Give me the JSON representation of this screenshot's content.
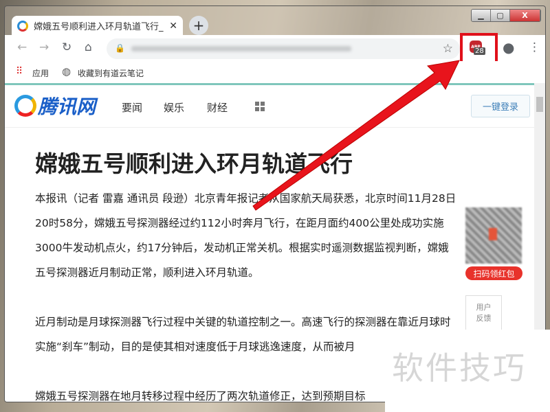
{
  "browser": {
    "tab_title": "嫦娥五号顺利进入环月轨道飞行_",
    "tab_close": "✕",
    "new_tab": "+",
    "window_controls": {
      "minimize": "▁",
      "maximize": "▢",
      "close": "X"
    },
    "abp_count": "28",
    "abp_label": "ABP",
    "bookmarks": [
      {
        "label": "应用",
        "icon": "apps-grid-icon"
      },
      {
        "label": "收藏到有道云笔记",
        "icon": "globe-icon"
      }
    ]
  },
  "site": {
    "logo": "腾讯网",
    "nav": [
      "要闻",
      "娱乐",
      "财经"
    ],
    "login": "一键登录"
  },
  "article": {
    "title": "嫦娥五号顺利进入环月轨道飞行",
    "para1": [
      "本报讯（记者 雷嘉 通讯员 段逊）北京青年报记者从国家航天局获悉，北京时间11月28日",
      "20时58分，嫦娥五号探测器经过约112小时奔月飞行，在距月面约400公里处成功实施",
      "3000牛发动机点火，约17分钟后，发动机正常关机。根据实时遥测数据监视判断，嫦娥",
      "五号探测器近月制动正常，顺利进入环月轨道。"
    ],
    "para2": [
      "近月制动是月球探测器飞行过程中关键的轨道控制之一。高速飞行的探测器在靠近月球时",
      "实施“刹车”制动，目的是使其相对速度低于月球逃逸速度，从而被月"
    ],
    "para3": [
      "嫦娥五号探测器在地月转移过程中经历了两次轨道修正，达到预期目标"
    ]
  },
  "side": {
    "qr_button": "扫码领红包",
    "feedback": [
      "用户",
      "反馈"
    ]
  },
  "watermark": "软件技巧",
  "colors": {
    "highlight": "#e0101a",
    "accent": "#1a5fc8"
  }
}
